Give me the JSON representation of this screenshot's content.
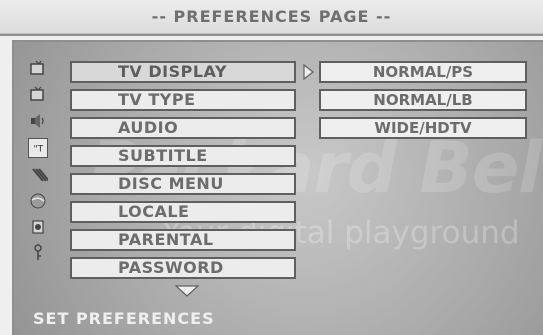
{
  "header": {
    "title": "-- PREFERENCES PAGE --"
  },
  "watermark": {
    "brand": "Packard Bell.",
    "tagline": "Your digital playground"
  },
  "icons": [
    {
      "name": "tv-display-icon"
    },
    {
      "name": "tv-type-icon"
    },
    {
      "name": "audio-icon"
    },
    {
      "name": "subtitle-icon"
    },
    {
      "name": "disc-menu-icon"
    },
    {
      "name": "locale-icon"
    },
    {
      "name": "parental-icon"
    },
    {
      "name": "password-icon"
    }
  ],
  "menu": {
    "items": [
      {
        "label": "TV DISPLAY"
      },
      {
        "label": "TV TYPE"
      },
      {
        "label": "AUDIO"
      },
      {
        "label": "SUBTITLE"
      },
      {
        "label": "DISC MENU"
      },
      {
        "label": "LOCALE"
      },
      {
        "label": "PARENTAL"
      },
      {
        "label": "PASSWORD"
      }
    ],
    "selected": "TV DISPLAY"
  },
  "submenu": {
    "items": [
      {
        "label": "NORMAL/PS"
      },
      {
        "label": "NORMAL/LB"
      },
      {
        "label": "WIDE/HDTV"
      }
    ]
  },
  "status": {
    "text": "SET PREFERENCES"
  },
  "colors": {
    "background": "#efefef",
    "screen": "#aaaaaa",
    "border": "#5f5f5f",
    "text": "#6c6c6c"
  }
}
